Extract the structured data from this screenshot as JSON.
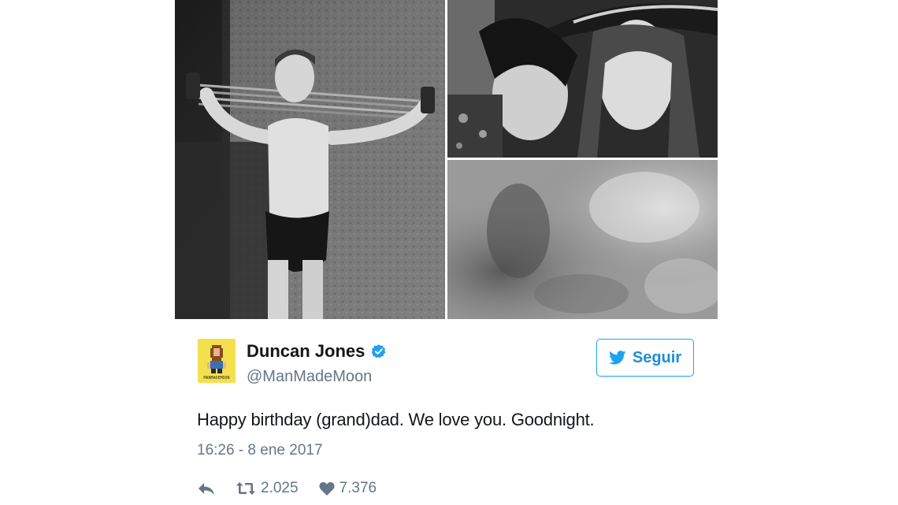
{
  "tweet": {
    "display_name": "Duncan Jones",
    "handle": "@ManMadeMoon",
    "text": "Happy birthday (grand)dad. We love you. Goodnight.",
    "timestamp": "16:26 - 8 ene 2017",
    "verified": true,
    "avatar_caption": "MANMADEMOON"
  },
  "follow": {
    "label": "Seguir",
    "icon": "twitter-bird-icon"
  },
  "actions": {
    "reply_icon": "reply-icon",
    "retweet_icon": "retweet-icon",
    "retweet_count": "2.025",
    "like_icon": "heart-icon",
    "like_count": "7.376"
  },
  "media": {
    "count": 3,
    "style": "black-and-white photographs"
  },
  "colors": {
    "accent": "#1da1f2",
    "text": "#14171a",
    "secondary_text": "#657786",
    "avatar_bg": "#f4e04d"
  }
}
